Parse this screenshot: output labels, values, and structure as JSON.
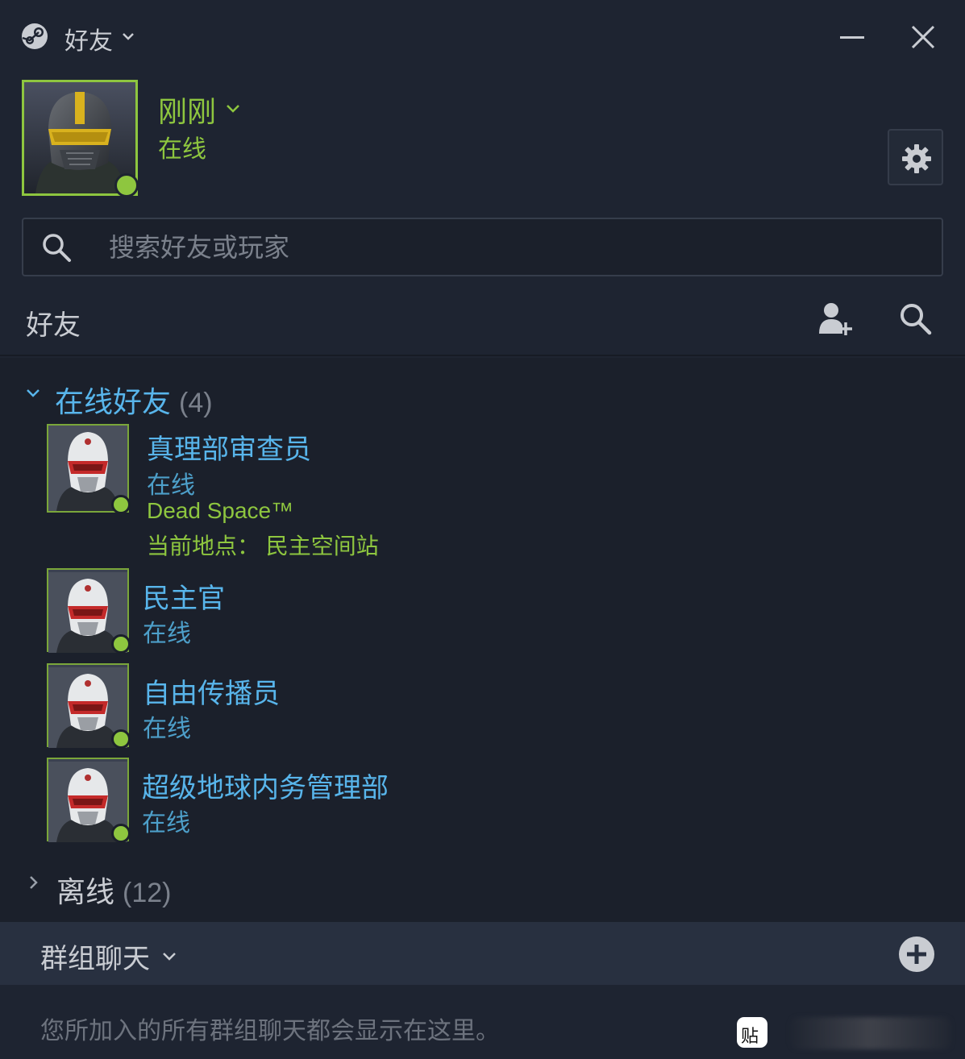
{
  "titlebar": {
    "title": "好友",
    "icons": {
      "logo": "steam-logo-icon",
      "caret": "chevron-down-icon",
      "minimize": "minimize-icon",
      "close": "close-icon"
    }
  },
  "profile": {
    "name": "刚刚",
    "status": "在线",
    "status_color": "#8ec63f",
    "settings_icon": "gear-icon"
  },
  "search": {
    "placeholder": "搜索好友或玩家",
    "value": ""
  },
  "friends_header": {
    "label": "好友",
    "add_icon": "add-friend-icon",
    "search_icon": "search-icon"
  },
  "online_group": {
    "title": "在线好友",
    "count": "(4)",
    "expanded": true,
    "color": "#58b5eb"
  },
  "friends": [
    {
      "name": "真理部审查员",
      "status": "在线",
      "game": "Dead Space™",
      "location": "当前地点： 民主空间站"
    },
    {
      "name": "民主官",
      "status": "在线"
    },
    {
      "name": "自由传播员",
      "status": "在线"
    },
    {
      "name": "超级地球内务管理部",
      "status": "在线"
    }
  ],
  "offline_group": {
    "title": "离线",
    "count": "(12)",
    "expanded": false
  },
  "group_chats": {
    "label": "群组聊天",
    "add_icon": "plus-circle-icon",
    "empty_text": "您所加入的所有群组聊天都会显示在这里。"
  },
  "watermark": {
    "badge_text": "贴"
  },
  "colors": {
    "online_green": "#8ec63f",
    "friend_blue": "#58b5eb",
    "background": "#1b202b"
  }
}
